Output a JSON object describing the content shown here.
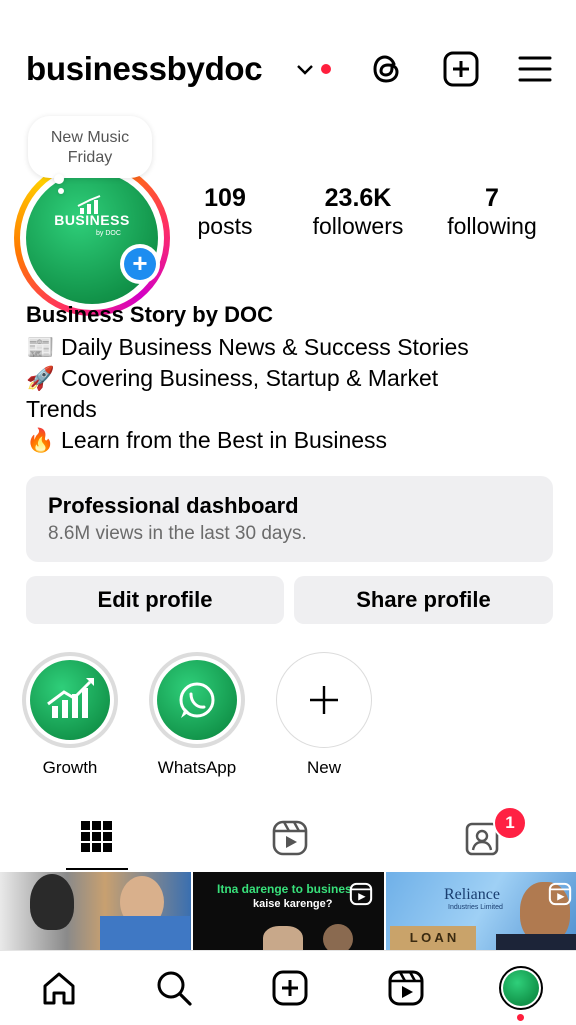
{
  "header": {
    "username": "businessbydoc"
  },
  "note": {
    "text_line1": "New Music",
    "text_line2": "Friday"
  },
  "avatar": {
    "text": "BUSINESS",
    "subtext": "by DOC"
  },
  "stats": [
    {
      "value": "109",
      "label": "posts"
    },
    {
      "value": "23.6K",
      "label": "followers"
    },
    {
      "value": "7",
      "label": "following"
    }
  ],
  "bio": {
    "name": "Business Story by DOC",
    "line1": "📰 Daily Business News & Success Stories",
    "line2": "🚀 Covering Business, Startup & Market",
    "line3": "Trends",
    "line4": "🔥 Learn from the Best in Business"
  },
  "dashboard": {
    "title": "Professional dashboard",
    "subtitle": "8.6M views in the last 30 days."
  },
  "buttons": {
    "edit": "Edit profile",
    "share": "Share profile"
  },
  "highlights": [
    {
      "label": "Growth",
      "icon": "growth-chart-icon"
    },
    {
      "label": "WhatsApp",
      "icon": "whatsapp-icon"
    },
    {
      "label": "New",
      "icon": "plus-icon"
    }
  ],
  "tabs": {
    "tagged_badge": "1"
  },
  "thumbs": {
    "t2_line1": "Itna darenge to busines",
    "t2_line2": "kaise karenge?",
    "t3_brand": "Reliance",
    "t3_sub": "Industries Limited",
    "t3_loan": "L O A N"
  },
  "colors": {
    "accent_blue": "#1d8df0",
    "notif_red": "#ff2143",
    "brand_green": "#12944a"
  }
}
